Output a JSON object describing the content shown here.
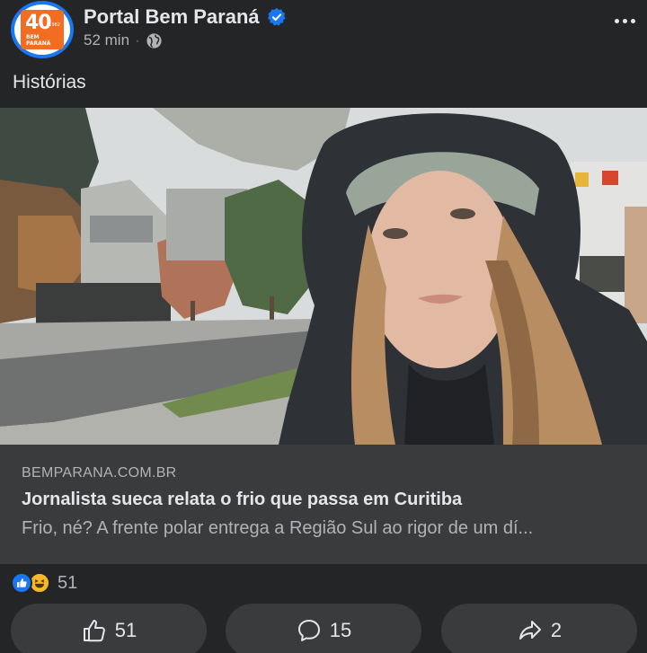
{
  "header": {
    "page_name": "Portal Bem Paraná",
    "time": "52 min",
    "separator": "·",
    "avatar_logo": {
      "number": "40",
      "year": "1982",
      "brand_line1": "BEM",
      "brand_line2": "PARANÁ"
    },
    "verified_icon": "verified-badge-icon",
    "privacy_icon": "globe-icon",
    "more_icon": "more-horizontal-icon"
  },
  "post": {
    "text": "Histórias"
  },
  "link_preview": {
    "domain": "BEMPARANA.COM.BR",
    "title": "Jornalista sueca relata o frio que passa em Curitiba",
    "description": "Frio, né? A frente polar entrega a Região Sul ao rigor de um dí..."
  },
  "reactions": {
    "types": [
      "like",
      "haha"
    ],
    "count": "51"
  },
  "actions": {
    "like_count": "51",
    "comment_count": "15",
    "share_count": "2"
  },
  "colors": {
    "background": "#242526",
    "card": "#3a3b3c",
    "accent": "#1877f2",
    "text_primary": "#e4e6eb",
    "text_secondary": "#b0b3b8",
    "logo_orange": "#f26c21",
    "haha_yellow": "#f7b928"
  }
}
